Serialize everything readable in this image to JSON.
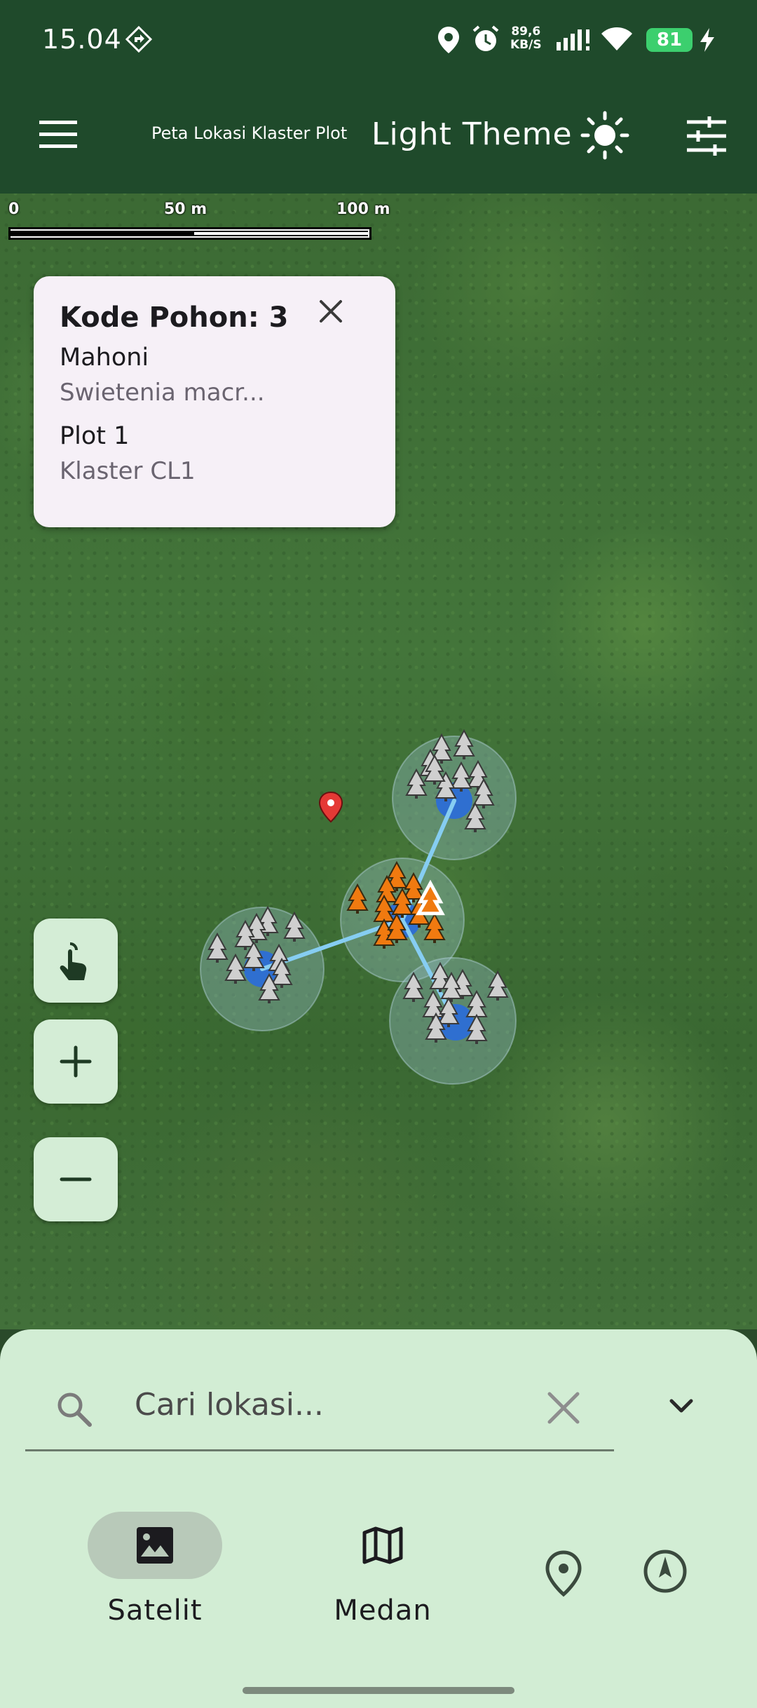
{
  "status_bar": {
    "time": "15.04",
    "net_speed_value": "89,6",
    "net_speed_unit": "KB/S",
    "battery": "81"
  },
  "app_bar": {
    "title": "Peta Lokasi Klaster Plot",
    "theme_label": "Light Theme"
  },
  "scale_bar": {
    "ticks": [
      "0",
      "50 m",
      "100 m"
    ]
  },
  "popup": {
    "title": "Kode Pohon: 3",
    "common_name": "Mahoni",
    "scientific_name": "Swietenia macr...",
    "plot": "Plot 1",
    "cluster": "Klaster CL1"
  },
  "search": {
    "placeholder": "Cari lokasi...",
    "value": ""
  },
  "modes": [
    {
      "label": "Satelit",
      "icon": "image-icon",
      "selected": true
    },
    {
      "label": "Medan",
      "icon": "map-icon",
      "selected": false
    }
  ],
  "icons": {
    "menu": "menu-icon",
    "theme": "sun-icon",
    "filter": "tune-icon",
    "close": "close-icon",
    "touch": "touch-icon",
    "zoom_in": "plus-icon",
    "zoom_out": "minus-icon",
    "search": "search-icon",
    "clear": "clear-icon",
    "collapse": "chevron-down-icon",
    "location": "location-pin-icon",
    "compass": "compass-icon"
  },
  "colors": {
    "app_bar": "#1f4a2b",
    "sheet": "#d2edd4",
    "plot_line": "#7fc8f0",
    "tree_gray": "#c9c9c9",
    "tree_orange": "#f07a10",
    "marker_red": "#e53935"
  }
}
